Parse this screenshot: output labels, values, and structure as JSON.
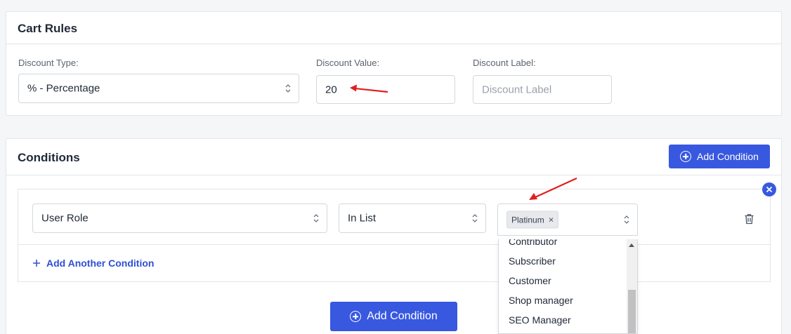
{
  "cart_rules": {
    "title": "Cart Rules",
    "discount_type_label": "Discount Type:",
    "discount_type_value": "% - Percentage",
    "discount_value_label": "Discount Value:",
    "discount_value": "20",
    "discount_label_label": "Discount Label:",
    "discount_label_placeholder": "Discount Label"
  },
  "conditions": {
    "title": "Conditions",
    "add_condition_label": "Add Condition",
    "row": {
      "field_value": "User Role",
      "operator_value": "In List",
      "selected_tags": [
        "Platinum"
      ]
    },
    "add_another_label": "Add Another Condition",
    "bottom_add_condition_label": "Add Condition",
    "dropdown_options": [
      "Contributor",
      "Subscriber",
      "Customer",
      "Shop manager",
      "SEO Manager"
    ]
  },
  "colors": {
    "accent": "#3858e0",
    "annotation_arrow": "#e02020",
    "link": "#2f4fd1"
  }
}
